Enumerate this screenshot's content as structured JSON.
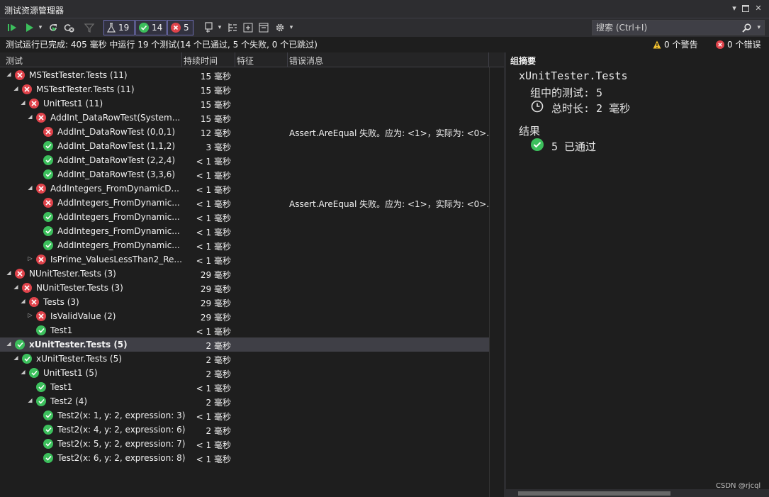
{
  "window": {
    "title": "测试资源管理器"
  },
  "toolbar": {
    "counts": {
      "total": "19",
      "passed": "14",
      "failed": "5"
    },
    "search_placeholder": "搜索 (Ctrl+I)"
  },
  "status": {
    "message": "测试运行已完成: 405 毫秒 中运行 19 个测试(14 个已通过, 5 个失败, 0 个已跳过)",
    "warnings": "0 个警告",
    "errors": "0 个错误"
  },
  "columns": {
    "test": "测试",
    "duration": "持续时间",
    "traits": "特征",
    "error_message": "错误消息"
  },
  "rows": [
    {
      "name": "MSTestTester.Tests (11)",
      "duration": "15 毫秒",
      "status": "fail",
      "indent": 0,
      "expander": "open",
      "error": ""
    },
    {
      "name": "MSTestTester.Tests (11)",
      "duration": "15 毫秒",
      "status": "fail",
      "indent": 1,
      "expander": "open",
      "error": ""
    },
    {
      "name": "UnitTest1 (11)",
      "duration": "15 毫秒",
      "status": "fail",
      "indent": 2,
      "expander": "open",
      "error": ""
    },
    {
      "name": "AddInt_DataRowTest(System...",
      "duration": "15 毫秒",
      "status": "fail",
      "indent": 3,
      "expander": "open",
      "error": ""
    },
    {
      "name": "AddInt_DataRowTest (0,0,1)",
      "duration": "12 毫秒",
      "status": "fail",
      "indent": 4,
      "expander": "",
      "error": "Assert.AreEqual 失败。应为: <1>，实际为: <0>..."
    },
    {
      "name": "AddInt_DataRowTest (1,1,2)",
      "duration": "3 毫秒",
      "status": "pass",
      "indent": 4,
      "expander": "",
      "error": ""
    },
    {
      "name": "AddInt_DataRowTest (2,2,4)",
      "duration": "< 1 毫秒",
      "status": "pass",
      "indent": 4,
      "expander": "",
      "error": ""
    },
    {
      "name": "AddInt_DataRowTest (3,3,6)",
      "duration": "< 1 毫秒",
      "status": "pass",
      "indent": 4,
      "expander": "",
      "error": ""
    },
    {
      "name": "AddIntegers_FromDynamicD...",
      "duration": "< 1 毫秒",
      "status": "fail",
      "indent": 3,
      "expander": "open",
      "error": ""
    },
    {
      "name": "AddIntegers_FromDynamic...",
      "duration": "< 1 毫秒",
      "status": "fail",
      "indent": 4,
      "expander": "",
      "error": "Assert.AreEqual 失败。应为: <1>，实际为: <0>..."
    },
    {
      "name": "AddIntegers_FromDynamic...",
      "duration": "< 1 毫秒",
      "status": "pass",
      "indent": 4,
      "expander": "",
      "error": ""
    },
    {
      "name": "AddIntegers_FromDynamic...",
      "duration": "< 1 毫秒",
      "status": "pass",
      "indent": 4,
      "expander": "",
      "error": ""
    },
    {
      "name": "AddIntegers_FromDynamic...",
      "duration": "< 1 毫秒",
      "status": "pass",
      "indent": 4,
      "expander": "",
      "error": ""
    },
    {
      "name": "IsPrime_ValuesLessThan2_Re...",
      "duration": "< 1 毫秒",
      "status": "fail",
      "indent": 3,
      "expander": "closed",
      "error": ""
    },
    {
      "name": "NUnitTester.Tests (3)",
      "duration": "29 毫秒",
      "status": "fail",
      "indent": 0,
      "expander": "open",
      "error": ""
    },
    {
      "name": "NUnitTester.Tests (3)",
      "duration": "29 毫秒",
      "status": "fail",
      "indent": 1,
      "expander": "open",
      "error": ""
    },
    {
      "name": "Tests (3)",
      "duration": "29 毫秒",
      "status": "fail",
      "indent": 2,
      "expander": "open",
      "error": ""
    },
    {
      "name": "IsValidValue (2)",
      "duration": "29 毫秒",
      "status": "fail",
      "indent": 3,
      "expander": "closed",
      "error": ""
    },
    {
      "name": "Test1",
      "duration": "< 1 毫秒",
      "status": "pass",
      "indent": 3,
      "expander": "",
      "error": ""
    },
    {
      "name": "xUnitTester.Tests (5)",
      "duration": "2 毫秒",
      "status": "pass",
      "indent": 0,
      "expander": "open",
      "error": "",
      "selected": true
    },
    {
      "name": "xUnitTester.Tests (5)",
      "duration": "2 毫秒",
      "status": "pass",
      "indent": 1,
      "expander": "open",
      "error": ""
    },
    {
      "name": "UnitTest1 (5)",
      "duration": "2 毫秒",
      "status": "pass",
      "indent": 2,
      "expander": "open",
      "error": ""
    },
    {
      "name": "Test1",
      "duration": "< 1 毫秒",
      "status": "pass",
      "indent": 3,
      "expander": "",
      "error": ""
    },
    {
      "name": "Test2 (4)",
      "duration": "2 毫秒",
      "status": "pass",
      "indent": 3,
      "expander": "open",
      "error": ""
    },
    {
      "name": "Test2(x: 1, y: 2, expression: 3)",
      "duration": "< 1 毫秒",
      "status": "pass",
      "indent": 4,
      "expander": "",
      "error": ""
    },
    {
      "name": "Test2(x: 4, y: 2, expression: 6)",
      "duration": "2 毫秒",
      "status": "pass",
      "indent": 4,
      "expander": "",
      "error": ""
    },
    {
      "name": "Test2(x: 5, y: 2, expression: 7)",
      "duration": "< 1 毫秒",
      "status": "pass",
      "indent": 4,
      "expander": "",
      "error": ""
    },
    {
      "name": "Test2(x: 6, y: 2, expression: 8)",
      "duration": "< 1 毫秒",
      "status": "pass",
      "indent": 4,
      "expander": "",
      "error": ""
    }
  ],
  "summary": {
    "header": "组摘要",
    "group_name": "xUnitTester.Tests",
    "tests_in_group": "组中的测试: 5",
    "total_duration": "总时长: 2 毫秒",
    "results_label": "结果",
    "passed": "5 已通过"
  },
  "watermark": "CSDN @rjcql",
  "colors": {
    "fail": "#e0434b",
    "pass": "#3cbf5c",
    "background": "#1e1e1e",
    "toolbar": "#2d2d30"
  }
}
